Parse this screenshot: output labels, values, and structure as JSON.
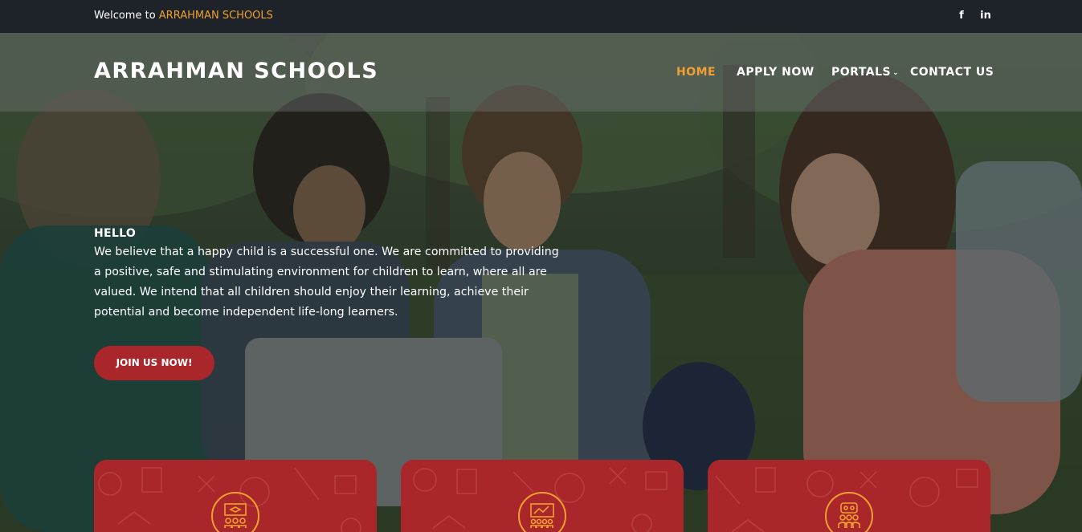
{
  "topbar": {
    "welcome_prefix": "Welcome to ",
    "welcome_brand": "ARRAHMAN SCHOOLS",
    "social": {
      "facebook": "f",
      "linkedin": "in"
    }
  },
  "header": {
    "logo": "ARRAHMAN SCHOOLS",
    "nav": {
      "home": "HOME",
      "apply": "APPLY NOW",
      "portals": "PORTALS",
      "portals_caret": "⌄",
      "contact": "CONTACT US"
    }
  },
  "hero": {
    "greeting": "HELLO",
    "text": "We believe that a happy child is a successful one. We are committed to providing a positive, safe and stimulating environment for children to learn, where all are valued. We intend that all children should enjoy their learning, achieve their potential and become independent life-long learners.",
    "cta_label": "JOIN US NOW!"
  },
  "cards": [
    {
      "icon": "classroom-teacher-icon"
    },
    {
      "icon": "presentation-board-icon"
    },
    {
      "icon": "student-group-icon"
    }
  ],
  "colors": {
    "accent": "#f0a030",
    "brand_red": "#a9272b",
    "topbar_bg": "#1d2328"
  }
}
